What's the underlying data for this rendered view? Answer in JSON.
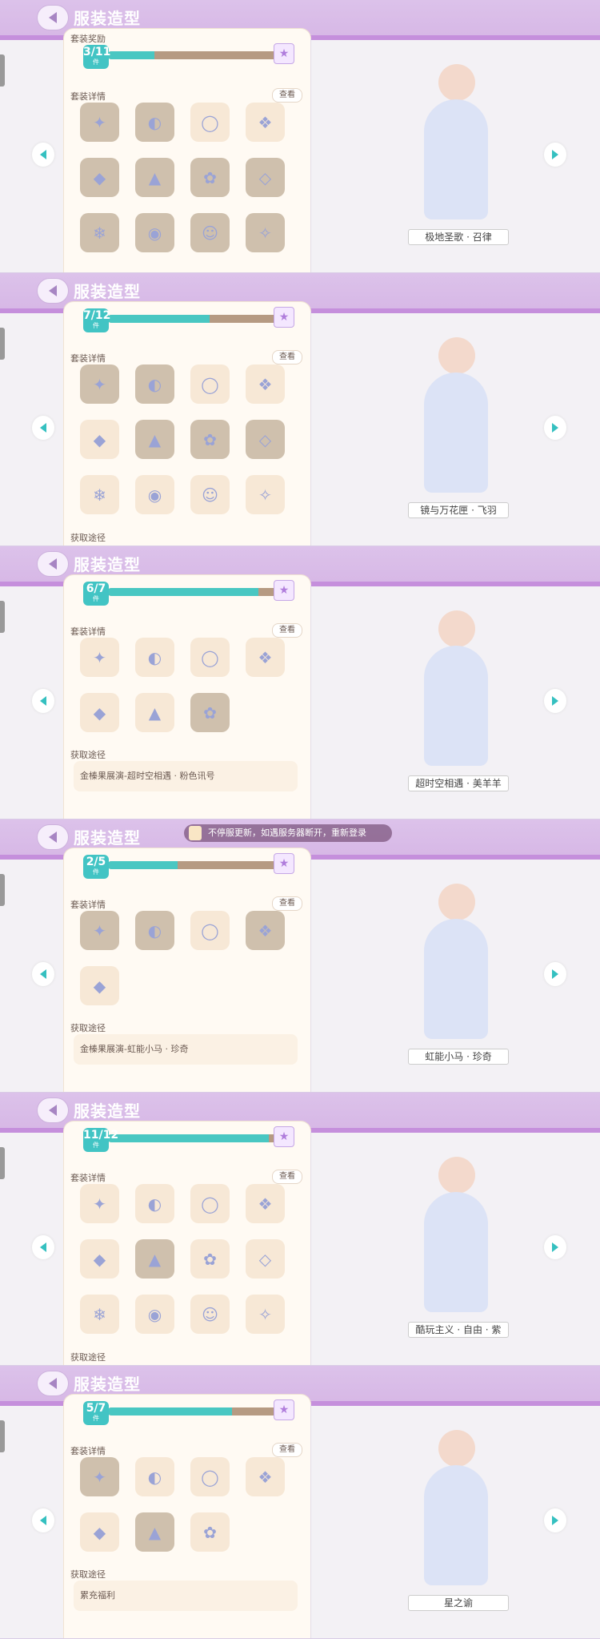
{
  "header_title": "服装造型",
  "labels": {
    "reward": "套装奖励",
    "details": "套装详情",
    "view": "查看",
    "acquire": "获取途径",
    "unit": "件"
  },
  "notice": "不停服更新，如遇服务器断开，重新登录",
  "screens": [
    {
      "count": "3/11",
      "progress": 0.27,
      "name": "极地圣歌 · 召律",
      "acquire_text": "",
      "items": 12,
      "owned": [
        0,
        1,
        4,
        5,
        6,
        7,
        8,
        9,
        10,
        11
      ]
    },
    {
      "count": "7/12",
      "progress": 0.58,
      "name": "镜与万花匣 · 飞羽",
      "acquire_text": "",
      "items": 12,
      "owned": [
        0,
        1,
        5,
        6,
        7
      ]
    },
    {
      "count": "6/7",
      "progress": 0.86,
      "name": "超时空相遇 · 美羊羊",
      "acquire_text": "金榛果展演-超时空相遇 · 粉色讯号",
      "items": 7,
      "owned": [
        6
      ]
    },
    {
      "count": "2/5",
      "progress": 0.4,
      "name": "虹能小马 · 珍奇",
      "acquire_text": "金榛果展演-虹能小马 · 珍奇",
      "items": 5,
      "owned": [
        0,
        1,
        3
      ]
    },
    {
      "count": "11/12",
      "progress": 0.92,
      "name": "酷玩主义 · 自由 · 紫",
      "acquire_text": "",
      "items": 12,
      "owned": [
        5
      ]
    },
    {
      "count": "5/7",
      "progress": 0.71,
      "name": "星之谕",
      "acquire_text": "累充福利",
      "items": 7,
      "owned": [
        0,
        5
      ]
    }
  ]
}
